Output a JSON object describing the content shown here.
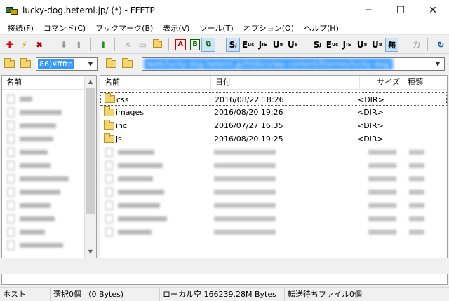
{
  "window": {
    "title": "lucky-dog.heteml.jp/ (*) - FFFTP",
    "minimize": "─",
    "maximize": "☐",
    "close": "✕"
  },
  "menu": [
    "接続(F)",
    "コマンド(C)",
    "ブックマーク(B)",
    "表示(V)",
    "ツール(T)",
    "オプション(O)",
    "ヘルプ(H)"
  ],
  "toolbar": {
    "kanji_label": "無",
    "kana_label": "カ"
  },
  "local": {
    "path": "86)¥ffftp",
    "column_name": "名前"
  },
  "remote": {
    "path": "/web/lucky-dog.heteml.jp/htdocs/wp-content/themes/lucky-dog/",
    "columns": {
      "name": "名前",
      "date": "日付",
      "size": "サイズ",
      "type": "種類"
    },
    "folders": [
      {
        "name": "css",
        "date": "2016/08/22 18:26",
        "size": "<DIR>"
      },
      {
        "name": "images",
        "date": "2016/08/20 19:26",
        "size": "<DIR>"
      },
      {
        "name": "inc",
        "date": "2016/07/27 16:35",
        "size": "<DIR>"
      },
      {
        "name": "js",
        "date": "2016/08/20 19:25",
        "size": "<DIR>"
      }
    ]
  },
  "status": {
    "host": "ホスト",
    "selection": "選択0個 （0 Bytes)",
    "local_free": "ローカル空 166239.28M Bytes",
    "queue": "転送待ちファイル0個"
  }
}
